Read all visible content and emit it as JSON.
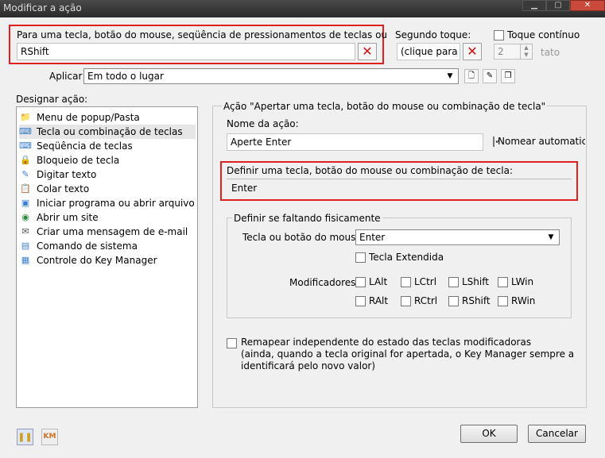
{
  "window": {
    "title": "Modificar a ação"
  },
  "original": {
    "label": "Para uma tecla, botão do mouse, seqüência de pressionamentos de teclas ou",
    "value": "RShift"
  },
  "second_touch": {
    "label": "Segundo toque:",
    "value": "(clique para d",
    "continuous_label": "Toque contínuo",
    "count_value": "2",
    "count_unit": "tato"
  },
  "apply": {
    "label": "Aplicar",
    "selected": "Em todo o lugar"
  },
  "designar": {
    "label": "Designar ação:",
    "items": [
      {
        "label": "Menu de popup/Pasta",
        "icon": "📁",
        "icon_name": "folder-icon"
      },
      {
        "label": "Tecla ou combinação de teclas",
        "icon": "⌨",
        "icon_name": "keyboard-icon"
      },
      {
        "label": "Seqüência de teclas",
        "icon": "⌨",
        "icon_name": "keyboard-sequence-icon"
      },
      {
        "label": "Bloqueio de tecla",
        "icon": "🔒",
        "icon_name": "lock-icon"
      },
      {
        "label": "Digitar texto",
        "icon": "✎",
        "icon_name": "text-icon"
      },
      {
        "label": "Colar texto",
        "icon": "📋",
        "icon_name": "clipboard-icon"
      },
      {
        "label": "Iniciar programa ou abrir arquivo",
        "icon": "▣",
        "icon_name": "program-icon"
      },
      {
        "label": "Abrir um site",
        "icon": "◉",
        "icon_name": "globe-icon"
      },
      {
        "label": "Criar uma mensagem de e-mail",
        "icon": "✉",
        "icon_name": "mail-icon"
      },
      {
        "label": "Comando de sistema",
        "icon": "▤",
        "icon_name": "system-icon"
      },
      {
        "label": "Controle do Key Manager",
        "icon": "▦",
        "icon_name": "key-manager-icon"
      }
    ]
  },
  "action": {
    "heading": "Ação \"Apertar uma tecla, botão do mouse ou combinação de tecla\"",
    "name_label": "Nome da ação:",
    "name_value": "Aperte Enter",
    "auto_name_label": "Nomear automatic",
    "define_label": "Definir uma tecla, botão do mouse ou combinação de tecla:",
    "define_value": "Enter"
  },
  "missing": {
    "title": "Definir se faltando fisicamente",
    "key_label": "Tecla ou botão do mouse",
    "key_value": "Enter",
    "extended_label": "Tecla Extendida",
    "modifiers_label": "Modificadores",
    "modifiers": [
      "LAlt",
      "LCtrl",
      "LShift",
      "LWin",
      "RAlt",
      "RCtrl",
      "RShift",
      "RWin"
    ]
  },
  "remap": {
    "line1": "Remapear independente do estado das teclas modificadoras",
    "line2": "(ainda, quando a tecla original for apertada, o Key Manager sempre a",
    "line3": "identificará pelo novo valor)"
  },
  "buttons": {
    "ok": "OK",
    "cancel": "Cancelar"
  }
}
